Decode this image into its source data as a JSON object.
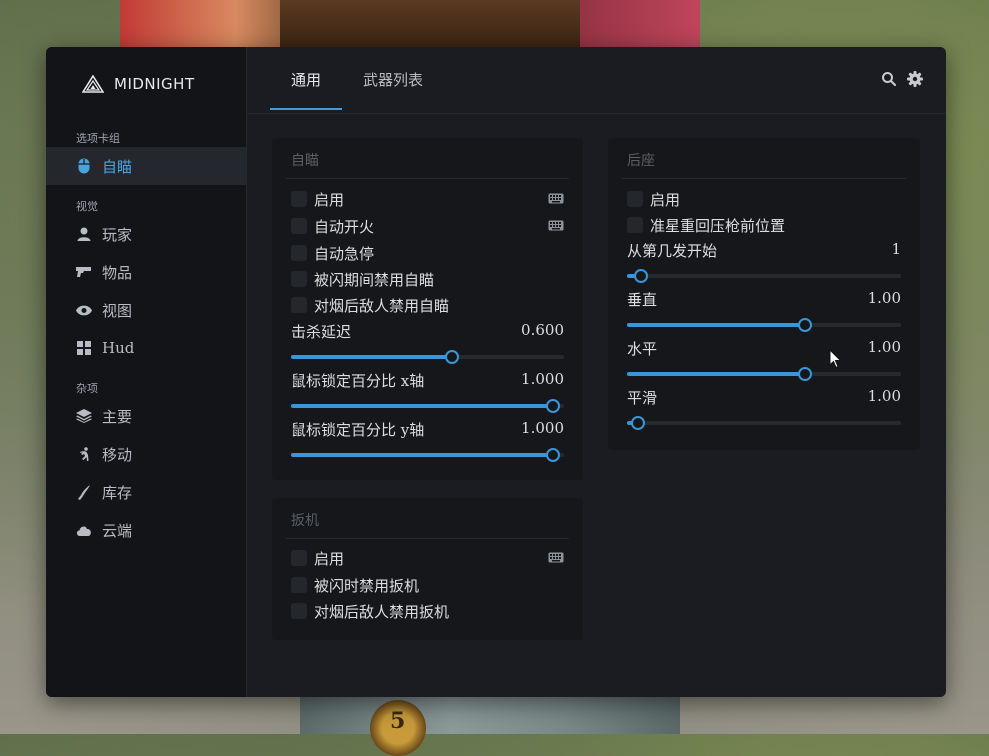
{
  "app": {
    "brand": "MIDNIGHT"
  },
  "sidebar": {
    "groups": [
      {
        "label": "选项卡组"
      },
      {
        "label": "视觉"
      },
      {
        "label": "杂项"
      }
    ],
    "items": [
      {
        "label": "自瞄",
        "icon": "mouse-icon",
        "active": true
      },
      {
        "label": "玩家",
        "icon": "user-icon"
      },
      {
        "label": "物品",
        "icon": "gun-icon"
      },
      {
        "label": "视图",
        "icon": "eye-icon"
      },
      {
        "label": "Hud",
        "icon": "grid-icon"
      },
      {
        "label": "主要",
        "icon": "layers-icon"
      },
      {
        "label": "移动",
        "icon": "running-icon"
      },
      {
        "label": "库存",
        "icon": "knife-icon"
      },
      {
        "label": "云端",
        "icon": "cloud-icon"
      }
    ]
  },
  "tabs": [
    {
      "label": "通用",
      "active": true
    },
    {
      "label": "武器列表"
    }
  ],
  "topbar": {
    "icons": [
      "search-icon",
      "gear-icon"
    ]
  },
  "aim_panel": {
    "title": "自瞄",
    "checkboxes": [
      {
        "label": "启用",
        "checked": false,
        "keybind": true
      },
      {
        "label": "自动开火",
        "checked": false,
        "keybind": true
      },
      {
        "label": "自动急停",
        "checked": false
      },
      {
        "label": "被闪期间禁用自瞄",
        "checked": false
      },
      {
        "label": "对烟后敌人禁用自瞄",
        "checked": false
      }
    ],
    "sliders": [
      {
        "label": "击杀延迟",
        "value": "0.600",
        "fraction": 0.59
      },
      {
        "label": "鼠标锁定百分比 x轴",
        "value": "1.000",
        "fraction": 0.96
      },
      {
        "label": "鼠标锁定百分比 y轴",
        "value": "1.000",
        "fraction": 0.96
      }
    ]
  },
  "trigger_panel": {
    "title": "扳机",
    "checkboxes": [
      {
        "label": "启用",
        "checked": false,
        "keybind": true
      },
      {
        "label": "被闪时禁用扳机",
        "checked": false
      },
      {
        "label": "对烟后敌人禁用扳机",
        "checked": false
      }
    ]
  },
  "recoil_panel": {
    "title": "后座",
    "checkboxes": [
      {
        "label": "启用",
        "checked": false
      },
      {
        "label": "准星重回压枪前位置",
        "checked": false
      }
    ],
    "sliders": [
      {
        "label": "从第几发开始",
        "value": "1",
        "fraction": 0.05
      },
      {
        "label": "垂直",
        "value": "1.00",
        "fraction": 0.65
      },
      {
        "label": "水平",
        "value": "1.00",
        "fraction": 0.65
      },
      {
        "label": "平滑",
        "value": "1.00",
        "fraction": 0.04
      }
    ]
  },
  "colors": {
    "accent": "#3a96d6",
    "panel": "#15171b",
    "window": "#1a1c21",
    "sidebar": "#121418"
  }
}
